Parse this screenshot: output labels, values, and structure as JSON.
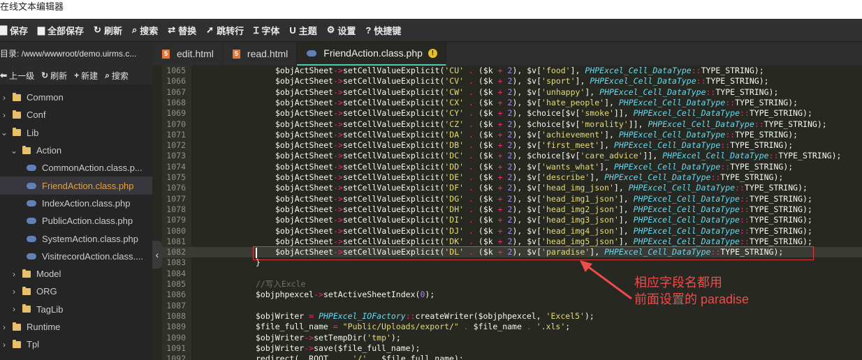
{
  "window": {
    "title": "在线文本编辑器"
  },
  "toolbar": {
    "items": [
      {
        "label": "保存",
        "icon": "save-icon",
        "glyph": "▇"
      },
      {
        "label": "全部保存",
        "icon": "save-all-icon",
        "glyph": "▆"
      },
      {
        "label": "刷新",
        "icon": "refresh-icon",
        "glyph": "↻"
      },
      {
        "label": "搜索",
        "icon": "search-icon",
        "glyph": "⌕"
      },
      {
        "label": "替换",
        "icon": "replace-icon",
        "glyph": "⇄"
      },
      {
        "label": "跳转行",
        "icon": "jump-line-icon",
        "glyph": "➚"
      },
      {
        "label": "字体",
        "icon": "font-icon",
        "glyph": "Ɪ"
      },
      {
        "label": "主题",
        "icon": "theme-icon",
        "glyph": "U"
      },
      {
        "label": "设置",
        "icon": "gear-icon",
        "glyph": "⚙"
      },
      {
        "label": "快捷键",
        "icon": "help-icon",
        "glyph": "?"
      }
    ]
  },
  "sidebar": {
    "path": "目录: /www/wwwroot/demo.uirms.c...",
    "actions": [
      {
        "label": "上一级",
        "icon": "up-level-icon",
        "glyph": "⬅"
      },
      {
        "label": "刷新",
        "icon": "refresh-icon",
        "glyph": "↻"
      },
      {
        "label": "新建",
        "icon": "plus-icon",
        "glyph": "+"
      },
      {
        "label": "搜索",
        "icon": "search-icon",
        "glyph": "⌕"
      }
    ],
    "tree": [
      {
        "label": "Common",
        "type": "folder",
        "depth": 0,
        "expanded": false
      },
      {
        "label": "Conf",
        "type": "folder",
        "depth": 0,
        "expanded": false
      },
      {
        "label": "Lib",
        "type": "folder",
        "depth": 0,
        "expanded": true
      },
      {
        "label": "Action",
        "type": "folder",
        "depth": 1,
        "expanded": true
      },
      {
        "label": "CommonAction.class.p...",
        "type": "php",
        "depth": 2
      },
      {
        "label": "FriendAction.class.php",
        "type": "php",
        "depth": 2,
        "selected": true
      },
      {
        "label": "IndexAction.class.php",
        "type": "php",
        "depth": 2
      },
      {
        "label": "PublicAction.class.php",
        "type": "php",
        "depth": 2
      },
      {
        "label": "SystemAction.class.php",
        "type": "php",
        "depth": 2
      },
      {
        "label": "VisitrecordAction.class....",
        "type": "php",
        "depth": 2
      },
      {
        "label": "Model",
        "type": "folder",
        "depth": 1,
        "expanded": false
      },
      {
        "label": "ORG",
        "type": "folder",
        "depth": 1,
        "expanded": false
      },
      {
        "label": "TagLib",
        "type": "folder",
        "depth": 1,
        "expanded": false
      },
      {
        "label": "Runtime",
        "type": "folder",
        "depth": 0,
        "expanded": false
      },
      {
        "label": "Tpl",
        "type": "folder",
        "depth": 0,
        "expanded": false
      }
    ]
  },
  "tabs": [
    {
      "label": "edit.html",
      "type": "html",
      "active": false
    },
    {
      "label": "read.html",
      "type": "html",
      "active": false
    },
    {
      "label": "FriendAction.class.php",
      "type": "php",
      "active": true,
      "warning": true
    }
  ],
  "editor": {
    "lines": [
      {
        "n": "1065",
        "code": "$objActSheet->setCellValueExplicit('CU' . ($k + 2), $v['food'], PHPExcel_Cell_DataType::TYPE_STRING);"
      },
      {
        "n": "1066",
        "code": "$objActSheet->setCellValueExplicit('CV' . ($k + 2), $v['sport'], PHPExcel_Cell_DataType::TYPE_STRING);"
      },
      {
        "n": "1067",
        "code": "$objActSheet->setCellValueExplicit('CW' . ($k + 2), $v['unhappy'], PHPExcel_Cell_DataType::TYPE_STRING);"
      },
      {
        "n": "1068",
        "code": "$objActSheet->setCellValueExplicit('CX' . ($k + 2), $v['hate_people'], PHPExcel_Cell_DataType::TYPE_STRING);"
      },
      {
        "n": "1069",
        "code": "$objActSheet->setCellValueExplicit('CY' . ($k + 2), $choice[$v['smoke']], PHPExcel_Cell_DataType::TYPE_STRING);"
      },
      {
        "n": "1070",
        "code": "$objActSheet->setCellValueExplicit('CZ' . ($k + 2), $choice[$v['morality']], PHPExcel_Cell_DataType::TYPE_STRING);"
      },
      {
        "n": "1071",
        "code": "$objActSheet->setCellValueExplicit('DA' . ($k + 2), $v['achievement'], PHPExcel_Cell_DataType::TYPE_STRING);"
      },
      {
        "n": "1072",
        "code": "$objActSheet->setCellValueExplicit('DB' . ($k + 2), $v['first_meet'], PHPExcel_Cell_DataType::TYPE_STRING);"
      },
      {
        "n": "1073",
        "code": "$objActSheet->setCellValueExplicit('DC' . ($k + 2), $choice[$v['care_advice']], PHPExcel_Cell_DataType::TYPE_STRING);"
      },
      {
        "n": "1074",
        "code": "$objActSheet->setCellValueExplicit('DD' . ($k + 2), $v['wants_what'], PHPExcel_Cell_DataType::TYPE_STRING);"
      },
      {
        "n": "1075",
        "code": "$objActSheet->setCellValueExplicit('DE' . ($k + 2), $v['describe'], PHPExcel_Cell_DataType::TYPE_STRING);"
      },
      {
        "n": "1076",
        "code": "$objActSheet->setCellValueExplicit('DF' . ($k + 2), $v['head_img_json'], PHPExcel_Cell_DataType::TYPE_STRING);"
      },
      {
        "n": "1077",
        "code": "$objActSheet->setCellValueExplicit('DG' . ($k + 2), $v['head_img1_json'], PHPExcel_Cell_DataType::TYPE_STRING);"
      },
      {
        "n": "1078",
        "code": "$objActSheet->setCellValueExplicit('DH' . ($k + 2), $v['head_img2_json'], PHPExcel_Cell_DataType::TYPE_STRING);"
      },
      {
        "n": "1079",
        "code": "$objActSheet->setCellValueExplicit('DI' . ($k + 2), $v['head_img3_json'], PHPExcel_Cell_DataType::TYPE_STRING);"
      },
      {
        "n": "1080",
        "code": "$objActSheet->setCellValueExplicit('DJ' . ($k + 2), $v['head_img4_json'], PHPExcel_Cell_DataType::TYPE_STRING);"
      },
      {
        "n": "1081",
        "code": "$objActSheet->setCellValueExplicit('DK' . ($k + 2), $v['head_img5_json'], PHPExcel_Cell_DataType::TYPE_STRING);"
      },
      {
        "n": "1082",
        "code": "$objActSheet->setCellValueExplicit('DL' . ($k + 2), $v['paradise'], PHPExcel_Cell_DataType::TYPE_STRING);",
        "current": true
      },
      {
        "n": "1083",
        "code": "}",
        "outdent": true
      },
      {
        "n": "1084",
        "code": ""
      },
      {
        "n": "1085",
        "code": "//写入Excle",
        "outdent": true
      },
      {
        "n": "1086",
        "code": "$objphpexcel->setActiveSheetIndex(0);",
        "outdent": true
      },
      {
        "n": "1087",
        "code": ""
      },
      {
        "n": "1088",
        "code": "$objWriter = PHPExcel_IOFactory::createWriter($objphpexcel, 'Excel5');",
        "outdent": true
      },
      {
        "n": "1089",
        "code": "$file_full_name = \"Public/Uploads/export/\" . $file_name . '.xls';",
        "outdent": true
      },
      {
        "n": "1090",
        "code": "$objWriter->setTempDir('tmp');",
        "outdent": true
      },
      {
        "n": "1091",
        "code": "$objWriter->save($file_full_name);",
        "outdent": true
      },
      {
        "n": "1092",
        "code": "redirect(__ROOT__ . '/' . $file_full_name);",
        "outdent": true
      }
    ]
  },
  "annotation": {
    "line1": "相应字段名都用",
    "line2": "前面设置的 paradise",
    "color": "#f04b4b"
  }
}
